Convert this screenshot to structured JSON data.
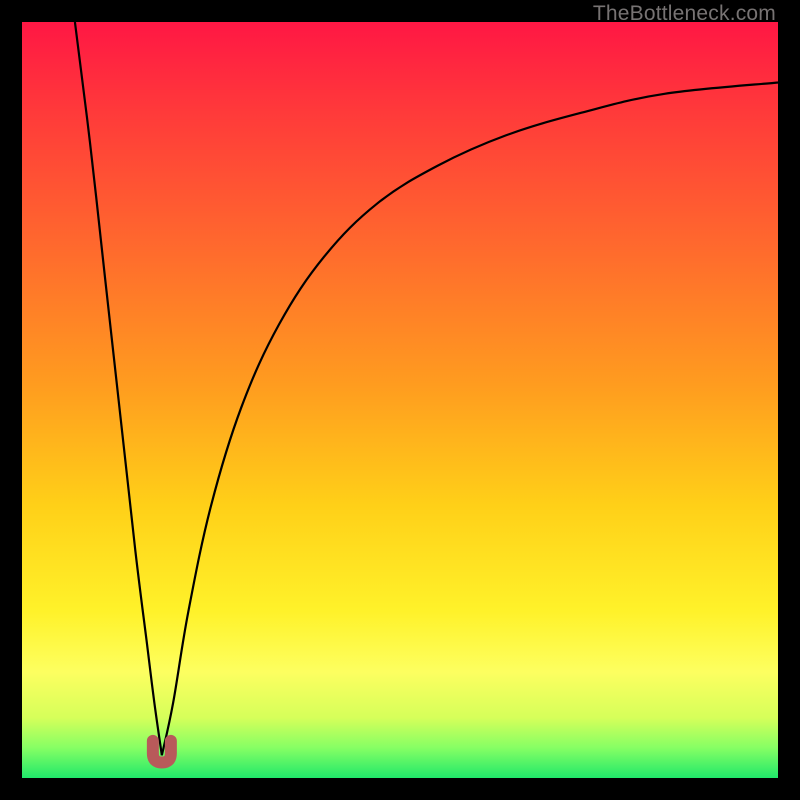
{
  "watermark": {
    "text": "TheBottleneck.com"
  },
  "gradient": {
    "type": "linear-vertical",
    "stops": [
      {
        "pct": 0,
        "color": "#ff1744"
      },
      {
        "pct": 12,
        "color": "#ff3a3a"
      },
      {
        "pct": 30,
        "color": "#ff6a2d"
      },
      {
        "pct": 48,
        "color": "#ff9c1f"
      },
      {
        "pct": 64,
        "color": "#ffd018"
      },
      {
        "pct": 78,
        "color": "#fff22a"
      },
      {
        "pct": 86,
        "color": "#fdff60"
      },
      {
        "pct": 92,
        "color": "#d6ff5a"
      },
      {
        "pct": 96,
        "color": "#86ff64"
      },
      {
        "pct": 100,
        "color": "#20e86a"
      }
    ]
  },
  "curve_style": {
    "stroke": "#000000",
    "stroke_width": 2.2
  },
  "trough_marker": {
    "stroke": "#b85a5a",
    "stroke_width": 12,
    "u_label": "u"
  },
  "chart_data": {
    "type": "line",
    "title": "",
    "xlabel": "",
    "ylabel": "",
    "xlim": [
      0,
      100
    ],
    "ylim": [
      0,
      100
    ],
    "note": "y≈0 is optimal (green); higher y is worse (red). Curve is |bottleneck %| vs a sweep parameter with a single minimum.",
    "trough_x": 18.5,
    "trough_y": 3,
    "series": [
      {
        "name": "bottleneck-left",
        "x": [
          7,
          9,
          11,
          13,
          15,
          16.5,
          17.5,
          18.5
        ],
        "y": [
          100,
          84,
          66,
          48,
          30,
          18,
          10,
          3
        ]
      },
      {
        "name": "bottleneck-right",
        "x": [
          18.5,
          20,
          22,
          25,
          29,
          34,
          40,
          47,
          55,
          64,
          74,
          85,
          100
        ],
        "y": [
          3,
          10,
          22,
          36,
          49,
          60,
          69,
          76,
          81,
          85,
          88,
          90.5,
          92
        ]
      }
    ]
  }
}
